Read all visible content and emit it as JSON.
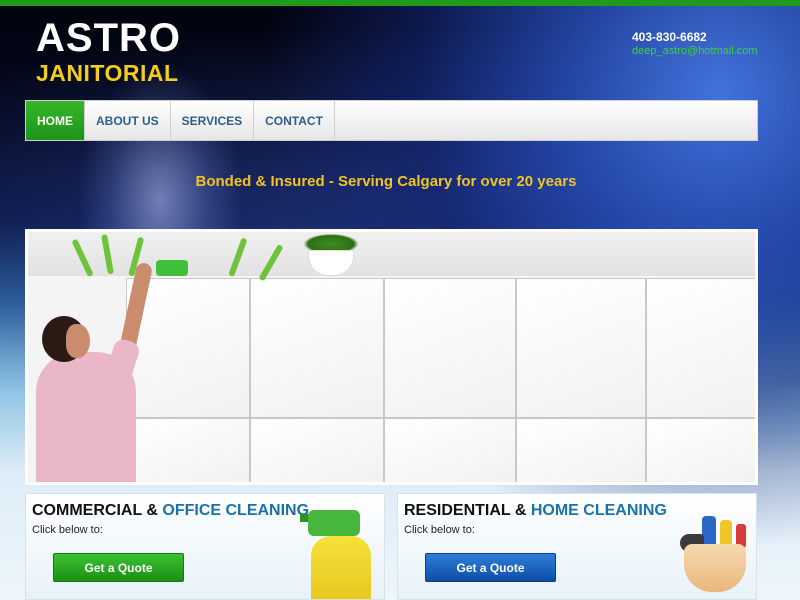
{
  "header": {
    "logo_line1": "ASTRO",
    "logo_line2": "JANITORIAL",
    "phone": "403-830-6682",
    "email": "deep_astro@hotmail.com"
  },
  "nav": {
    "items": [
      {
        "label": "HOME",
        "active": true
      },
      {
        "label": "ABOUT US",
        "active": false
      },
      {
        "label": "SERVICES",
        "active": false
      },
      {
        "label": "CONTACT",
        "active": false
      }
    ]
  },
  "tagline": "Bonded & Insured - Serving Calgary for over 20 years",
  "panels": {
    "commercial": {
      "title_main": "COMMERCIAL & ",
      "title_accent": "OFFICE CLEANING",
      "subtitle": "Click below to:",
      "button_label": "Get a Quote"
    },
    "residential": {
      "title_main": "RESIDENTIAL & ",
      "title_accent": "HOME CLEANING",
      "subtitle": "Click below to:",
      "button_label": "Get a Quote"
    }
  },
  "colors": {
    "brand_green": "#1f9a1a",
    "logo_yellow": "#f3cc1c",
    "email_green": "#39d33a",
    "nav_text": "#2b5e8a",
    "accent_blue": "#1b72a6",
    "button_green": "#1b8f14",
    "button_blue": "#0e4ea6"
  }
}
